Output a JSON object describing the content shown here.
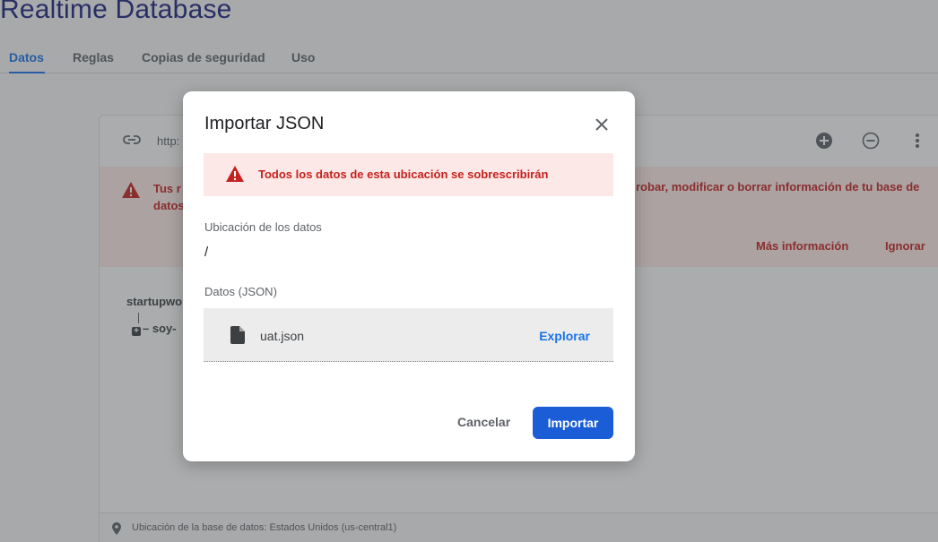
{
  "page": {
    "title": "Realtime Database"
  },
  "tabs": [
    {
      "label": "Datos",
      "active": true
    },
    {
      "label": "Reglas",
      "active": false
    },
    {
      "label": "Copias de seguridad",
      "active": false
    },
    {
      "label": "Uso",
      "active": false
    }
  ],
  "db_card": {
    "url_prefix": "http:",
    "header_icons": [
      "add-circle-icon",
      "remove-circle-icon",
      "more-vert-icon"
    ],
    "alert": {
      "text_left": "Tus r datos",
      "text_right": "robar, modificar o borrar información de tu base de",
      "learn_more": "Más información",
      "dismiss": "Ignorar"
    },
    "tree": {
      "root": "startupwo",
      "child": "soy-"
    },
    "footer": "Ubicación de la base de datos: Estados Unidos (us-central1)"
  },
  "dialog": {
    "title": "Importar JSON",
    "warning": "Todos los datos de esta ubicación se sobrescribirán",
    "location_label": "Ubicación de los datos",
    "location_value": "/",
    "json_label": "Datos (JSON)",
    "file_name": "uat.json",
    "browse_label": "Explorar",
    "cancel_label": "Cancelar",
    "import_label": "Importar"
  },
  "colors": {
    "accent": "#1a73e8",
    "primary_button": "#1a5dd6",
    "warning_bg": "#fce8e6",
    "warning_text": "#c5221f",
    "title": "#1a237e"
  }
}
